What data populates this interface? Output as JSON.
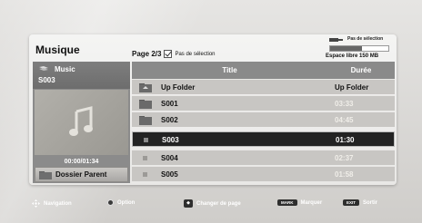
{
  "header": {
    "title": "Musique",
    "page_label": "Page 2/3",
    "selection_label": "Pas de sélection"
  },
  "storage": {
    "icon": "usb-icon",
    "label": "Pas de sélection",
    "free": "Espace libre 150 MB",
    "used_fraction": 0.55
  },
  "now_playing": {
    "folder": "Music",
    "track": "S003",
    "time": "00:00/01:34",
    "icon": "music-note-icon"
  },
  "parent_button": {
    "label": "Dossier Parent"
  },
  "list": {
    "columns": {
      "title": "Title",
      "duration": "Durée"
    },
    "rows": [
      {
        "name": "Up Folder",
        "duration": "Up Folder",
        "kind": "folder",
        "selected": false
      },
      {
        "name": "S001",
        "duration": "03:33",
        "kind": "folder",
        "selected": false
      },
      {
        "name": "S002",
        "duration": "04:45",
        "kind": "folder",
        "selected": false
      },
      {
        "name": "S003",
        "duration": "01:30",
        "kind": "file",
        "selected": true
      },
      {
        "name": "S004",
        "duration": "02:37",
        "kind": "file",
        "selected": false
      },
      {
        "name": "S005",
        "duration": "01:58",
        "kind": "file",
        "selected": false
      }
    ]
  },
  "footer": {
    "navigation": "Navigation",
    "option": "Option",
    "page_change": "Changer de page",
    "mark_key": "MARK",
    "mark": "Marquer",
    "exit_key": "EXIT",
    "exit": "Sortir"
  },
  "colors": {
    "header_bar": "#8a8a8a",
    "row_bg": "#c8c6c3",
    "selected_row": "#232323"
  }
}
